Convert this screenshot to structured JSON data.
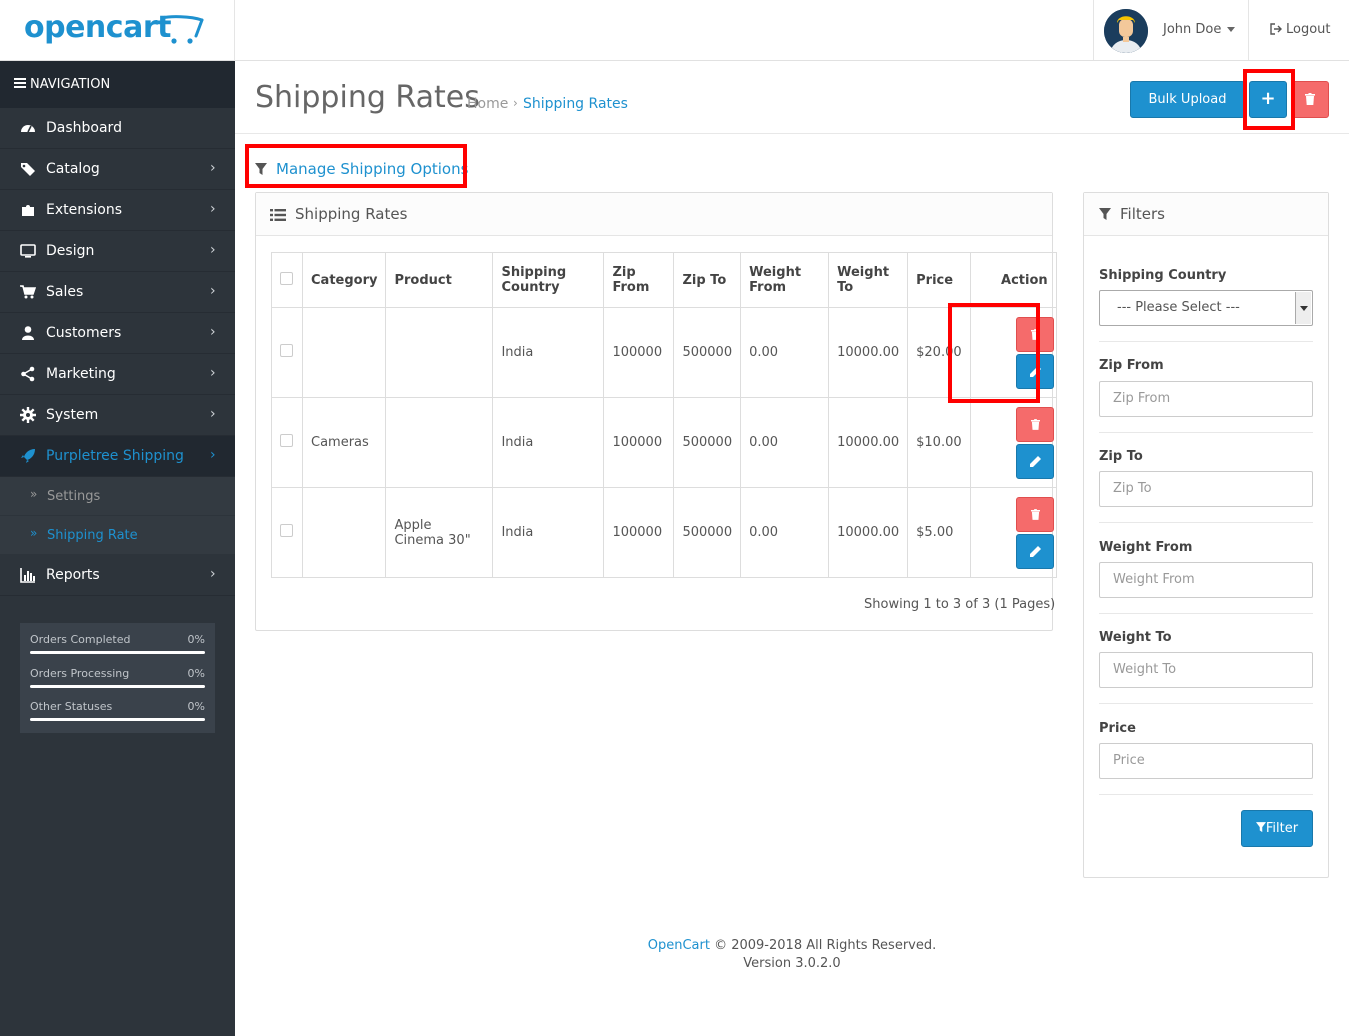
{
  "brand": {
    "logo_text": "opencart",
    "color": "#1e91cf"
  },
  "header": {
    "user_name": "John Doe",
    "logout_label": "Logout"
  },
  "sidebar": {
    "nav_heading": "NAVIGATION",
    "items": [
      {
        "label": "Dashboard",
        "icon": "dashboard-icon",
        "has_children": false
      },
      {
        "label": "Catalog",
        "icon": "tags-icon",
        "has_children": true
      },
      {
        "label": "Extensions",
        "icon": "puzzle-icon",
        "has_children": true
      },
      {
        "label": "Design",
        "icon": "monitor-icon",
        "has_children": true
      },
      {
        "label": "Sales",
        "icon": "cart-icon",
        "has_children": true
      },
      {
        "label": "Customers",
        "icon": "user-icon",
        "has_children": true
      },
      {
        "label": "Marketing",
        "icon": "share-icon",
        "has_children": true
      },
      {
        "label": "System",
        "icon": "gear-icon",
        "has_children": true
      },
      {
        "label": "Purpletree Shipping",
        "icon": "rocket-icon",
        "has_children": true,
        "active": true
      },
      {
        "label": "Reports",
        "icon": "bar-chart-icon",
        "has_children": true
      }
    ],
    "subitems": [
      {
        "label": "Settings"
      },
      {
        "label": "Shipping Rate",
        "current": true
      }
    ],
    "stats": [
      {
        "label": "Orders Completed",
        "value": "0%",
        "progress": 0
      },
      {
        "label": "Orders Processing",
        "value": "0%",
        "progress": 0
      },
      {
        "label": "Other Statuses",
        "value": "0%",
        "progress": 0
      }
    ]
  },
  "page": {
    "title": "Shipping Rates",
    "breadcrumb": [
      "Home",
      "Shipping Rates"
    ],
    "buttons": {
      "bulk_upload": "Bulk Upload",
      "add": "+",
      "delete": "delete"
    },
    "manage_link": "Manage Shipping Options"
  },
  "list_panel": {
    "title": "Shipping Rates",
    "columns": [
      "Category",
      "Product",
      "Shipping Country",
      "Zip From",
      "Zip To",
      "Weight From",
      "Weight To",
      "Price",
      "Action"
    ],
    "rows": [
      {
        "category": "",
        "product": "",
        "country": "India",
        "zip_from": "100000",
        "zip_to": "500000",
        "weight_from": "0.00",
        "weight_to": "10000.00",
        "price": "$20.00"
      },
      {
        "category": "Cameras",
        "product": "",
        "country": "India",
        "zip_from": "100000",
        "zip_to": "500000",
        "weight_from": "0.00",
        "weight_to": "10000.00",
        "price": "$10.00"
      },
      {
        "category": "",
        "product": "Apple Cinema 30\"",
        "country": "India",
        "zip_from": "100000",
        "zip_to": "500000",
        "weight_from": "0.00",
        "weight_to": "10000.00",
        "price": "$5.00"
      }
    ],
    "pagination_text": "Showing 1 to 3 of 3 (1 Pages)"
  },
  "filters": {
    "title": "Filters",
    "shipping_country": {
      "label": "Shipping Country",
      "value": " --- Please Select --- "
    },
    "zip_from": {
      "label": "Zip From",
      "placeholder": "Zip From"
    },
    "zip_to": {
      "label": "Zip To",
      "placeholder": "Zip To"
    },
    "weight_from": {
      "label": "Weight From",
      "placeholder": "Weight From"
    },
    "weight_to": {
      "label": "Weight To",
      "placeholder": "Weight To"
    },
    "price": {
      "label": "Price",
      "placeholder": "Price"
    },
    "filter_button": "Filter"
  },
  "footer": {
    "link": "OpenCart",
    "copyright": "© 2009-2018 All Rights Reserved.",
    "version": "Version 3.0.2.0"
  },
  "colors": {
    "primary": "#1e91cf",
    "danger": "#f56b6b",
    "sidebar": "#2d343b",
    "highlight": "#ff0000"
  }
}
